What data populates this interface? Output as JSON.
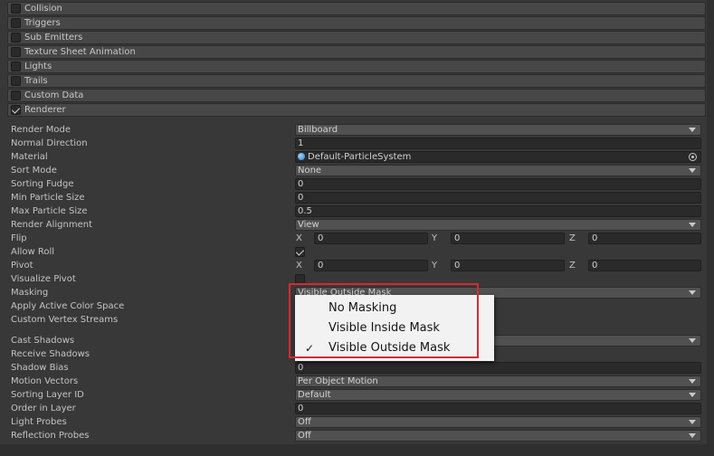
{
  "modules": [
    {
      "label": "Collision",
      "checked": false
    },
    {
      "label": "Triggers",
      "checked": false
    },
    {
      "label": "Sub Emitters",
      "checked": false
    },
    {
      "label": "Texture Sheet Animation",
      "checked": false
    },
    {
      "label": "Lights",
      "checked": false
    },
    {
      "label": "Trails",
      "checked": false
    },
    {
      "label": "Custom Data",
      "checked": false
    },
    {
      "label": "Renderer",
      "checked": true
    }
  ],
  "renderer": {
    "render_mode": {
      "label": "Render Mode",
      "value": "Billboard"
    },
    "normal_direction": {
      "label": "Normal Direction",
      "value": "1"
    },
    "material": {
      "label": "Material",
      "value": "Default-ParticleSystem"
    },
    "sort_mode": {
      "label": "Sort Mode",
      "value": "None"
    },
    "sorting_fudge": {
      "label": "Sorting Fudge",
      "value": "0"
    },
    "min_particle_size": {
      "label": "Min Particle Size",
      "value": "0"
    },
    "max_particle_size": {
      "label": "Max Particle Size",
      "value": "0.5"
    },
    "render_alignment": {
      "label": "Render Alignment",
      "value": "View"
    },
    "flip": {
      "label": "Flip",
      "x_label": "X",
      "x": "0",
      "y_label": "Y",
      "y": "0",
      "z_label": "Z",
      "z": "0"
    },
    "allow_roll": {
      "label": "Allow Roll",
      "checked": true
    },
    "pivot": {
      "label": "Pivot",
      "x_label": "X",
      "x": "0",
      "y_label": "Y",
      "y": "0",
      "z_label": "Z",
      "z": "0"
    },
    "visualize_pivot": {
      "label": "Visualize Pivot",
      "checked": false
    },
    "masking": {
      "label": "Masking",
      "value": "Visible Outside Mask"
    },
    "apply_active_color_space": {
      "label": "Apply Active Color Space"
    },
    "custom_vertex_streams": {
      "label": "Custom Vertex Streams"
    },
    "cast_shadows": {
      "label": "Cast Shadows",
      "value": ""
    },
    "receive_shadows": {
      "label": "Receive Shadows"
    },
    "shadow_bias": {
      "label": "Shadow Bias",
      "value": "0"
    },
    "motion_vectors": {
      "label": "Motion Vectors",
      "value": "Per Object Motion"
    },
    "sorting_layer_id": {
      "label": "Sorting Layer ID",
      "value": "Default"
    },
    "order_in_layer": {
      "label": "Order in Layer",
      "value": "0"
    },
    "light_probes": {
      "label": "Light Probes",
      "value": "Off"
    },
    "reflection_probes": {
      "label": "Reflection Probes",
      "value": "Off"
    }
  },
  "masking_menu": {
    "options": [
      {
        "label": "No Masking",
        "selected": false
      },
      {
        "label": "Visible Inside Mask",
        "selected": false
      },
      {
        "label": "Visible Outside Mask",
        "selected": true
      }
    ],
    "check_glyph": "✓"
  },
  "colors": {
    "highlight": "#d62a32",
    "panel": "#383838",
    "field": "#2a2a2a"
  }
}
